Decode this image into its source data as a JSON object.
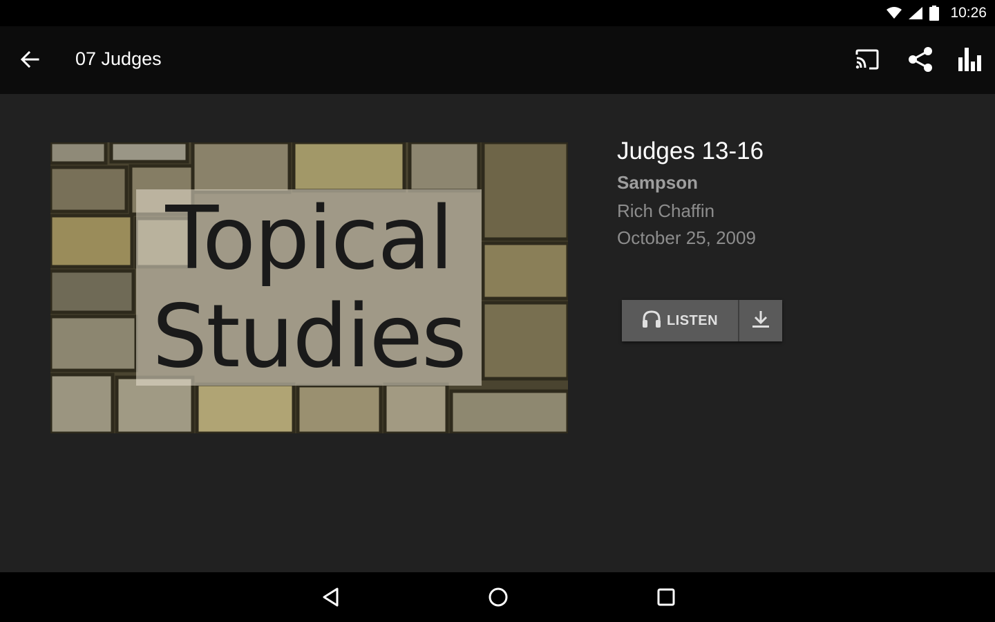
{
  "status_bar": {
    "time": "10:26",
    "icons": [
      "wifi-icon",
      "cell-signal-icon",
      "battery-icon"
    ]
  },
  "toolbar": {
    "back_icon": "arrow-back-icon",
    "title": "07 Judges",
    "actions": [
      "cast-icon",
      "share-icon",
      "bar-chart-icon"
    ]
  },
  "artwork": {
    "line1": "Topical",
    "line2": "Studies"
  },
  "message": {
    "title": "Judges 13-16",
    "subtitle": "Sampson",
    "speaker": "Rich Chaffin",
    "date": "October 25, 2009"
  },
  "actions": {
    "listen_label": "LISTEN",
    "listen_icon": "headphones-icon",
    "download_icon": "download-icon"
  },
  "nav_bar": {
    "buttons": [
      "nav-back-icon",
      "nav-home-icon",
      "nav-recents-icon"
    ]
  },
  "colors": {
    "background": "#212121",
    "toolbar": "#0c0c0c",
    "button": "#5a5a5a"
  }
}
